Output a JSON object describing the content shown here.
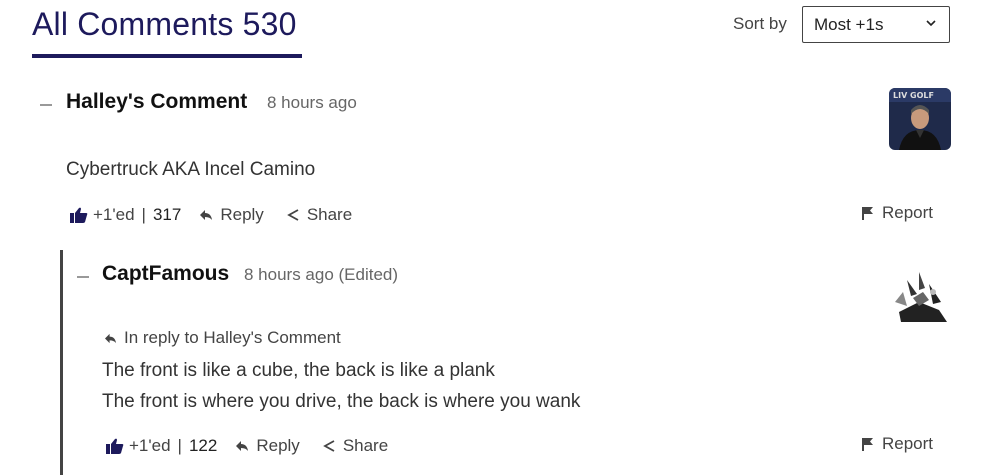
{
  "header": {
    "title": "All Comments 530",
    "sort_label": "Sort by",
    "sort_value": "Most +1s"
  },
  "comments": [
    {
      "author": "Halley's Comment",
      "time": "8 hours ago",
      "body": "Cybertruck AKA Incel Camino",
      "like_label": "+1'ed",
      "separator": "|",
      "like_count": "317",
      "reply_label": "Reply",
      "share_label": "Share",
      "report_label": "Report",
      "avatar_icon": "user-avatar-photo"
    },
    {
      "author": "CaptFamous",
      "time": "8 hours ago (Edited)",
      "reply_to": "In reply to Halley's Comment",
      "body_lines": [
        "The front is like a cube, the back is like a plank",
        "The front is where you drive, the back is where you wank"
      ],
      "like_label": "+1'ed",
      "separator": "|",
      "like_count": "122",
      "reply_label": "Reply",
      "share_label": "Share",
      "report_label": "Report",
      "avatar_icon": "user-avatar-art"
    }
  ],
  "colors": {
    "accent": "#1d1a5c",
    "text": "#222222",
    "muted": "#666666"
  }
}
